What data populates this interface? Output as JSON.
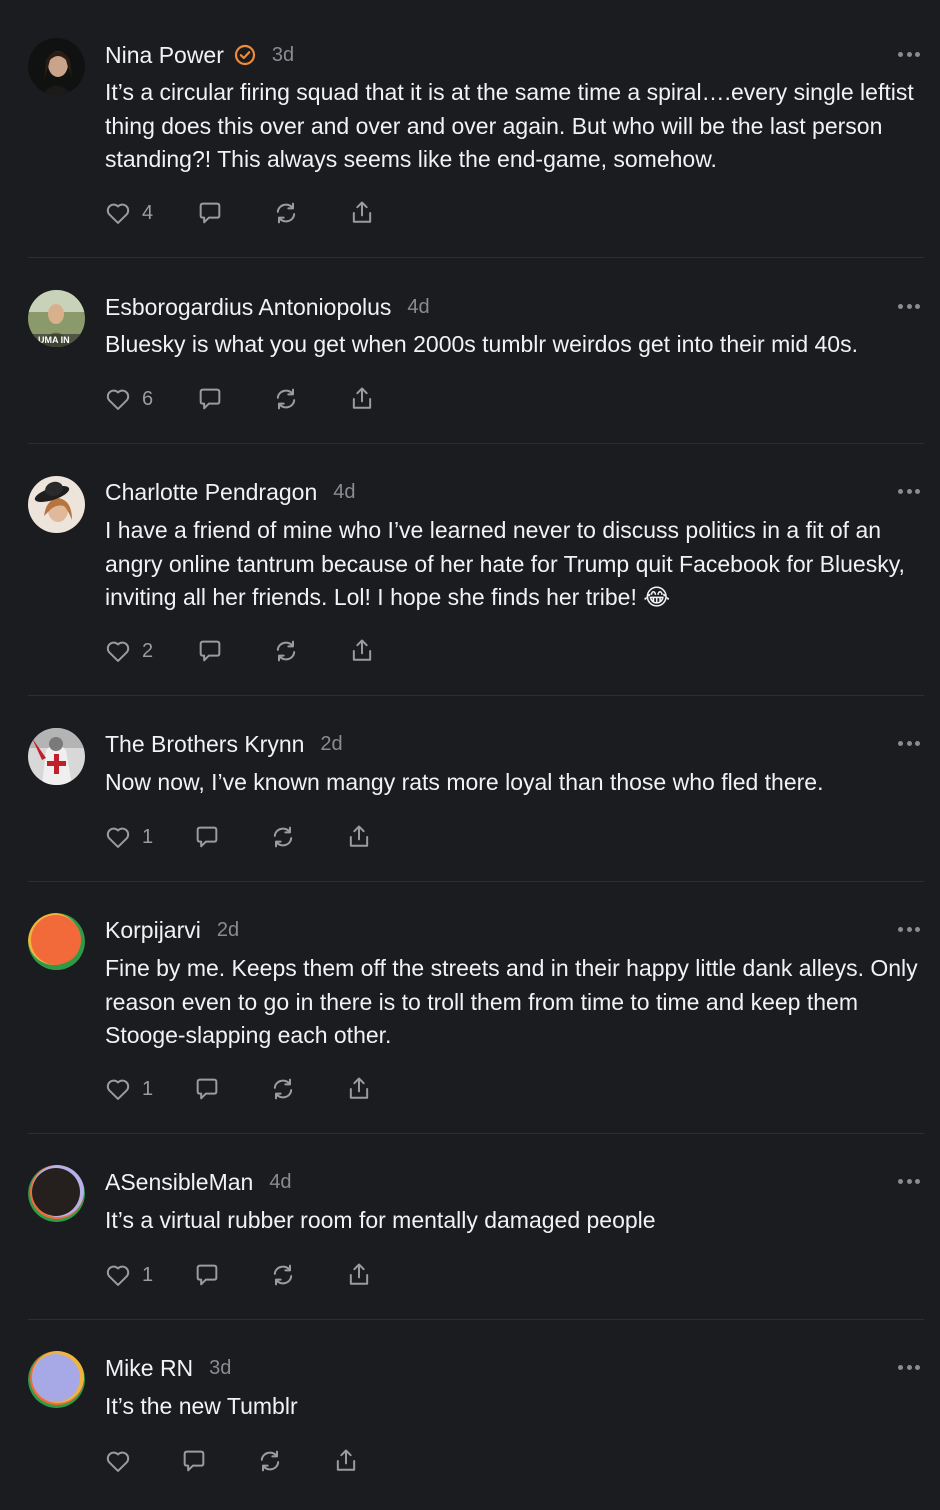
{
  "comments": [
    {
      "author": "Nina Power",
      "verified": true,
      "time": "3d",
      "text": "It’s a circular firing squad that it is at the same time a spiral….every single leftist thing does this over and over and over again. But who will be the last person standing?! This always seems like the end-game, somehow.",
      "likes": "4",
      "avatar": "photo-dark-portrait"
    },
    {
      "author": "Esborogardius Antoniopolus",
      "verified": false,
      "time": "4d",
      "text": "Bluesky is what you get when 2000s tumblr weirdos get into their mid 40s.",
      "likes": "6",
      "avatar": "photo-man-outdoors",
      "avatar_text": "UMA IN"
    },
    {
      "author": "Charlotte Pendragon",
      "verified": false,
      "time": "4d",
      "text": "I have a friend of mine who I’ve learned never to discuss politics in a fit of an angry online tantrum because of her hate for Trump quit Facebook for Bluesky, inviting all her friends. Lol! I hope she finds her tribe! 😂",
      "likes": "2",
      "avatar": "photo-woman-hat"
    },
    {
      "author": "The Brothers Krynn",
      "verified": false,
      "time": "2d",
      "text": "Now now, I’ve known mangy rats more loyal than those who fled there.",
      "likes": "1",
      "avatar": "photo-knight"
    },
    {
      "author": "Korpijarvi",
      "verified": false,
      "time": "2d",
      "text": "Fine by me. Keeps them off the streets and in their happy little dank alleys. Only reason even to go in there is to troll them from time to time and keep them Stooge-slapping each other.",
      "likes": "1",
      "avatar": "default-orange"
    },
    {
      "author": "ASensibleMan",
      "verified": false,
      "time": "4d",
      "text": "It’s a virtual rubber room for mentally damaged people",
      "likes": "1",
      "avatar": "default-dark"
    },
    {
      "author": "Mike RN",
      "verified": false,
      "time": "3d",
      "text": "It’s the new Tumblr",
      "likes": "",
      "avatar": "default-lavender"
    }
  ],
  "colors": {
    "background": "#1b1c1f",
    "text": "#f2f2f4",
    "muted": "#8a8c91",
    "divider": "#2e2f33",
    "verified_badge": "#f08a36"
  },
  "icons": [
    "heart-icon",
    "comment-bubble-icon",
    "repost-icon",
    "share-icon",
    "more-options-icon",
    "verified-badge-icon"
  ]
}
